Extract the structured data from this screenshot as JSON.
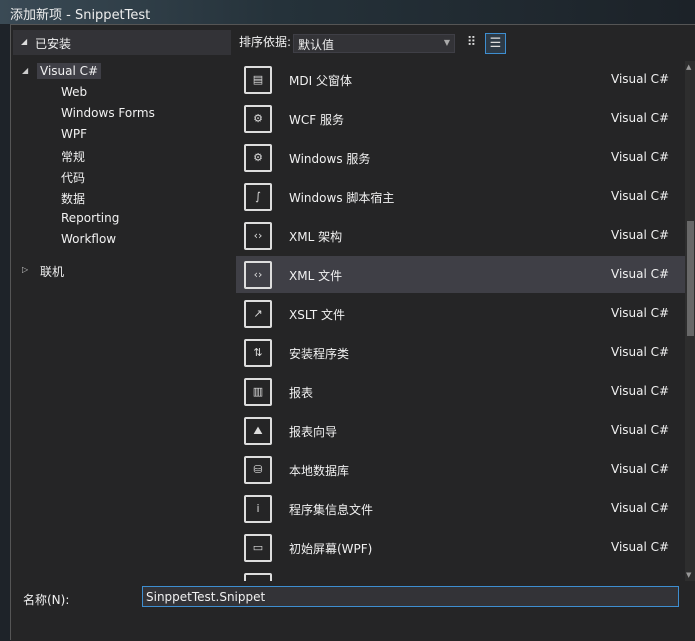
{
  "window": {
    "title": "添加新项 - SnippetTest"
  },
  "left_panel": {
    "header": "已安装",
    "tree": [
      {
        "label": "Visual C#",
        "level": 0,
        "expanded": true,
        "selected": true
      },
      {
        "label": "Web",
        "level": 1
      },
      {
        "label": "Windows Forms",
        "level": 1
      },
      {
        "label": "WPF",
        "level": 1
      },
      {
        "label": "常规",
        "level": 1
      },
      {
        "label": "代码",
        "level": 1
      },
      {
        "label": "数据",
        "level": 1
      },
      {
        "label": "Reporting",
        "level": 1
      },
      {
        "label": "Workflow",
        "level": 1
      },
      {
        "label": "联机",
        "level": 0,
        "expanded": false
      }
    ]
  },
  "toolbar": {
    "sort_label": "排序依据:",
    "sort_value": "默认值",
    "view_icons": [
      "small-icons-view-icon",
      "list-view-icon"
    ],
    "active_view": "list"
  },
  "items": [
    {
      "name": "MDI 父窗体",
      "lang": "Visual C#",
      "icon": "mdi-form-icon",
      "glyph": "▤"
    },
    {
      "name": "WCF 服务",
      "lang": "Visual C#",
      "icon": "wcf-service-icon",
      "glyph": "⚙"
    },
    {
      "name": "Windows 服务",
      "lang": "Visual C#",
      "icon": "windows-service-icon",
      "glyph": "⚙"
    },
    {
      "name": "Windows 脚本宿主",
      "lang": "Visual C#",
      "icon": "script-host-icon",
      "glyph": "∫"
    },
    {
      "name": "XML 架构",
      "lang": "Visual C#",
      "icon": "xml-schema-icon",
      "glyph": "‹›"
    },
    {
      "name": "XML 文件",
      "lang": "Visual C#",
      "icon": "xml-file-icon",
      "glyph": "‹›",
      "selected": true
    },
    {
      "name": "XSLT 文件",
      "lang": "Visual C#",
      "icon": "xslt-file-icon",
      "glyph": "↗"
    },
    {
      "name": "安装程序类",
      "lang": "Visual C#",
      "icon": "installer-class-icon",
      "glyph": "⇅"
    },
    {
      "name": "报表",
      "lang": "Visual C#",
      "icon": "report-icon",
      "glyph": "▥"
    },
    {
      "name": "报表向导",
      "lang": "Visual C#",
      "icon": "report-wizard-icon",
      "glyph": "⛰"
    },
    {
      "name": "本地数据库",
      "lang": "Visual C#",
      "icon": "local-database-icon",
      "glyph": "⛁"
    },
    {
      "name": "程序集信息文件",
      "lang": "Visual C#",
      "icon": "assembly-info-icon",
      "glyph": "i"
    },
    {
      "name": "初始屏幕(WPF)",
      "lang": "Visual C#",
      "icon": "splash-screen-icon",
      "glyph": "▭"
    },
    {
      "name": "",
      "lang": "",
      "icon": "partial-item-icon",
      "glyph": ""
    }
  ],
  "name_field": {
    "label": "名称(N):",
    "value": "SinppetTest.Snippet"
  }
}
